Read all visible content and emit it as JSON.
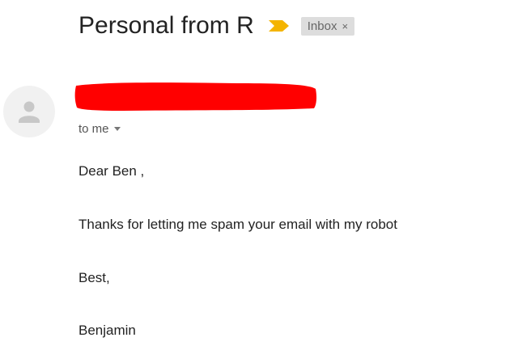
{
  "email": {
    "subject": "Personal from R",
    "label": "Inbox",
    "label_close": "×",
    "recipient_line": "to me",
    "body": {
      "greeting": "Dear Ben ,",
      "message": "Thanks for letting me spam your email with my robot",
      "closing": "Best,",
      "signature": "Benjamin"
    }
  },
  "icons": {
    "importance": "importance-marker-icon",
    "avatar": "default-person-icon",
    "details_toggle": "chevron-down-icon"
  },
  "colors": {
    "importance_marker": "#f4b400",
    "redaction": "#ff0000",
    "label_background": "#dddddd",
    "avatar_background": "#f1f1f1",
    "avatar_glyph": "#c8c8c8"
  }
}
